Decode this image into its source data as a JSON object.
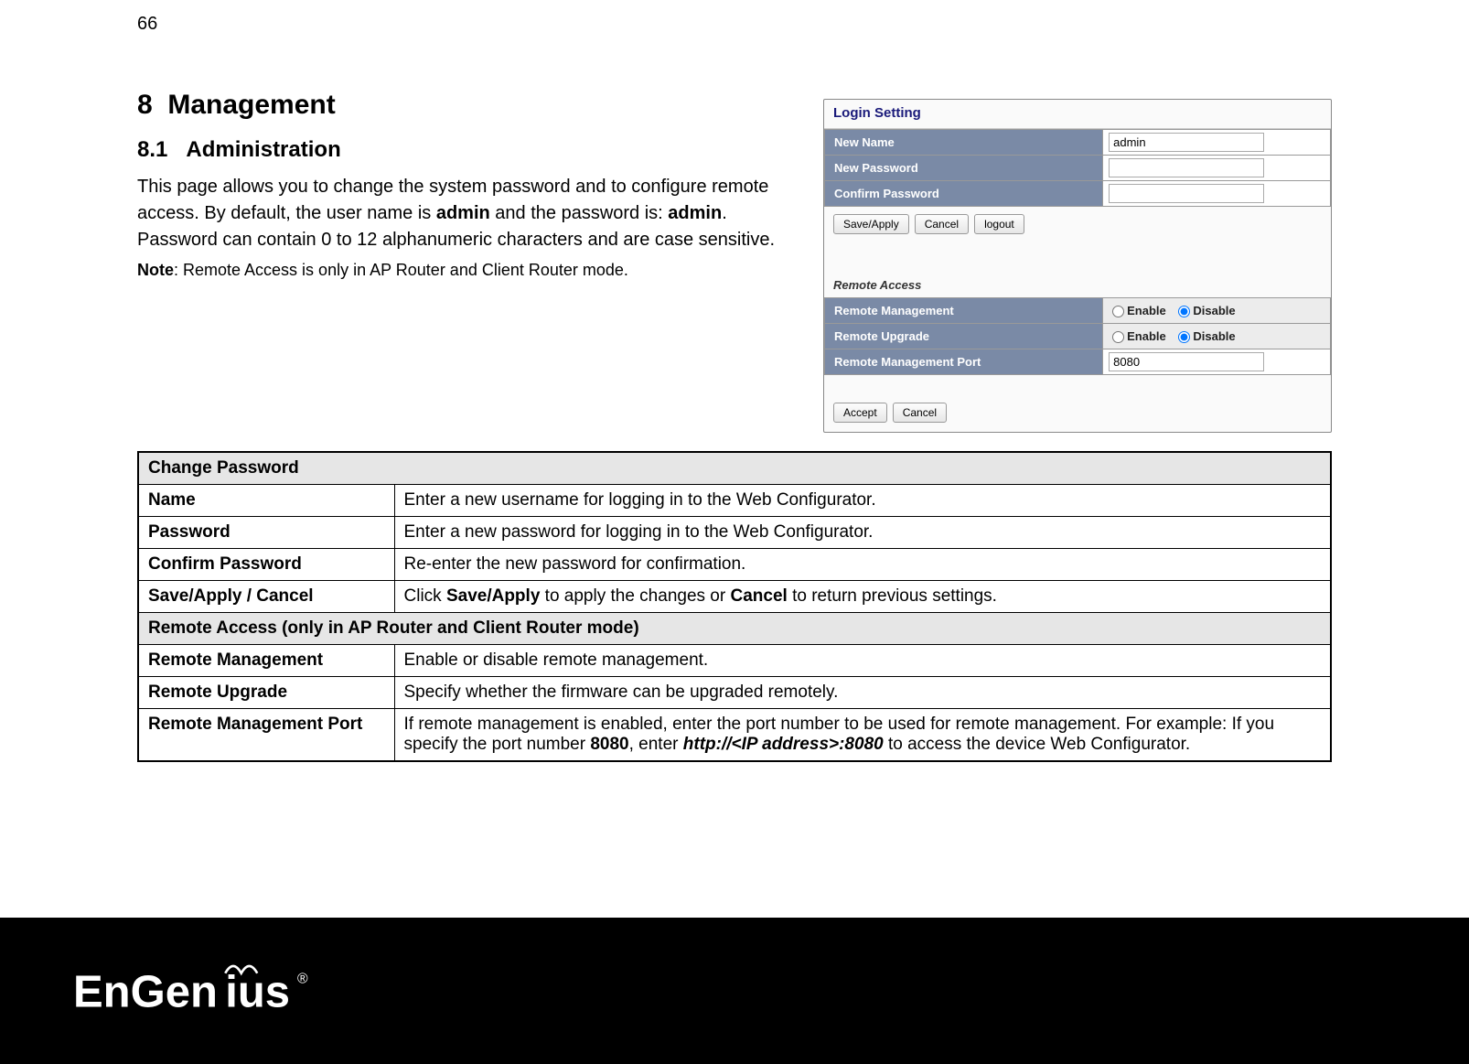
{
  "page_number": "66",
  "section_num": "8",
  "section_title": "Management",
  "subsection_num": "8.1",
  "subsection_title": "Administration",
  "intro_p1_a": "This page allows you to change the system password and to configure remote access. By default, the user name is ",
  "intro_p1_b": "admin",
  "intro_p1_c": " and the password is: ",
  "intro_p1_d": "admin",
  "intro_p1_e": ". Password can contain 0 to 12 alphanumeric characters and are case sensitive.",
  "note_label": "Note",
  "note_text": ": Remote Access is only in AP Router and Client Router mode.",
  "screenshot": {
    "login_title": "Login Setting",
    "row_newname": "New Name",
    "val_newname": "admin",
    "row_newpass": "New Password",
    "row_confpass": "Confirm Password",
    "btn_save": "Save/Apply",
    "btn_cancel": "Cancel",
    "btn_logout": "logout",
    "remote_title": "Remote Access",
    "row_rmgmt": "Remote Management",
    "row_rupg": "Remote Upgrade",
    "row_rport": "Remote Management Port",
    "val_rport": "8080",
    "opt_enable": "Enable",
    "opt_disable": "Disable",
    "btn_accept": "Accept",
    "btn_cancel2": "Cancel"
  },
  "table": {
    "hdr1": "Change Password",
    "r1_name": "Name",
    "r1_desc": "Enter a new username for logging in to the Web Configurator.",
    "r2_name": "Password",
    "r2_desc": "Enter a new password for logging in to the Web Configurator.",
    "r3_name": "Confirm Password",
    "r3_desc": "Re-enter the new password for confirmation.",
    "r4_name": "Save/Apply / Cancel",
    "r4_desc_a": "Click ",
    "r4_desc_b": "Save/Apply",
    "r4_desc_c": " to apply the changes or ",
    "r4_desc_d": "Cancel",
    "r4_desc_e": " to return previous settings.",
    "hdr2": "Remote Access (only in AP Router and Client Router mode)",
    "r5_name": "Remote Management",
    "r5_desc": "Enable or disable remote management.",
    "r6_name": "Remote Upgrade",
    "r6_desc": "Specify whether the firmware can be upgraded remotely.",
    "r7_name": "Remote Management Port",
    "r7_desc_a": "If remote management is enabled, enter the port number to be used for remote management. For example: If you specify the port number ",
    "r7_desc_b": "8080",
    "r7_desc_c": ", enter ",
    "r7_desc_d": "http://<IP address>:8080",
    "r7_desc_e": " to access the device Web Configurator."
  },
  "logo_text": "EnGenius",
  "logo_reg": "®"
}
